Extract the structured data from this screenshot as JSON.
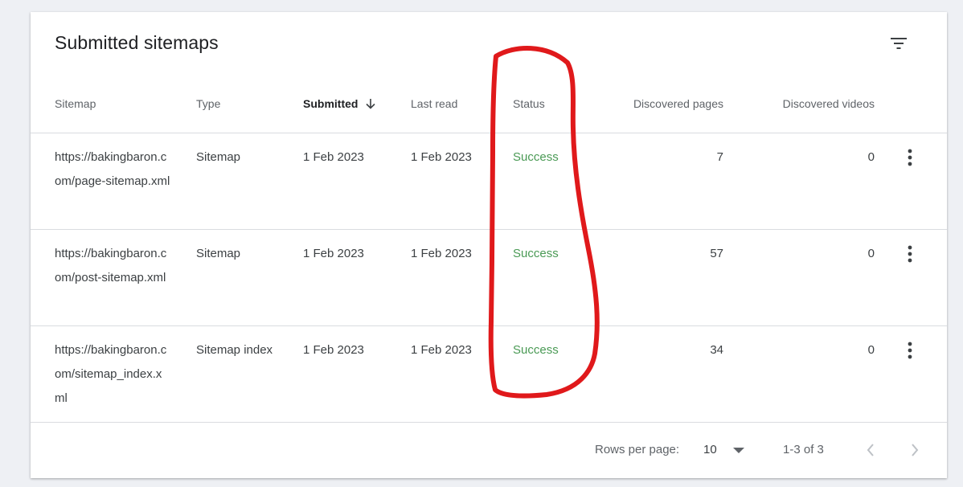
{
  "card": {
    "title": "Submitted sitemaps",
    "filter_icon": "filter-list-icon"
  },
  "table": {
    "columns": {
      "sitemap": "Sitemap",
      "type": "Type",
      "submitted": "Submitted",
      "last_read": "Last read",
      "status": "Status",
      "discovered_pages": "Discovered pages",
      "discovered_videos": "Discovered videos"
    },
    "sort": {
      "column": "submitted",
      "direction": "descending",
      "icon": "arrow-down-icon"
    },
    "rows": [
      {
        "sitemap": "https://bakingbaron.com/page-sitemap.xml",
        "type": "Sitemap",
        "submitted": "1 Feb 2023",
        "last_read": "1 Feb 2023",
        "status": "Success",
        "discovered_pages": "7",
        "discovered_videos": "0"
      },
      {
        "sitemap": "https://bakingbaron.com/post-sitemap.xml",
        "type": "Sitemap",
        "submitted": "1 Feb 2023",
        "last_read": "1 Feb 2023",
        "status": "Success",
        "discovered_pages": "57",
        "discovered_videos": "0"
      },
      {
        "sitemap": "https://bakingbaron.com/sitemap_index.xml",
        "type": "Sitemap index",
        "submitted": "1 Feb 2023",
        "last_read": "1 Feb 2023",
        "status": "Success",
        "discovered_pages": "34",
        "discovered_videos": "0"
      }
    ]
  },
  "footer": {
    "rows_per_page_label": "Rows per page:",
    "rows_per_page_value": "10",
    "range": "1-3 of 3"
  },
  "colors": {
    "success": "#4a9a55",
    "annotation": "#e0191b",
    "header_text": "#5f6368"
  }
}
